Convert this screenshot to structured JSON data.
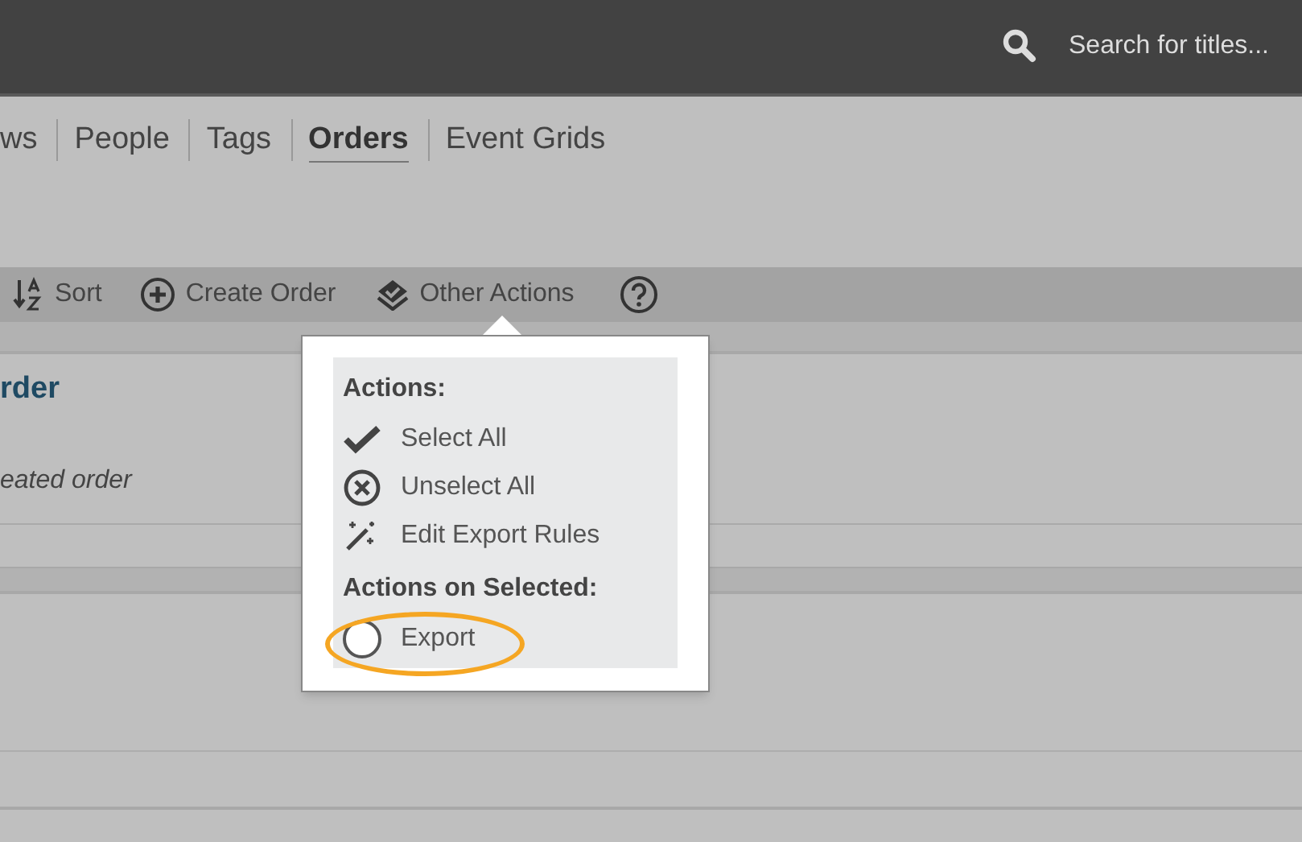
{
  "header": {
    "search_placeholder": "Search for titles..."
  },
  "tabs": [
    {
      "label": "ws",
      "selected": false
    },
    {
      "label": "People",
      "selected": false
    },
    {
      "label": "Tags",
      "selected": false
    },
    {
      "label": "Orders",
      "selected": true
    },
    {
      "label": "Event Grids",
      "selected": false
    }
  ],
  "toolbar": [
    {
      "kind": "sort",
      "label": "Sort"
    },
    {
      "kind": "create",
      "label": "Create Order"
    },
    {
      "kind": "other",
      "label": "Other Actions"
    },
    {
      "kind": "help"
    }
  ],
  "cards": [
    {
      "title": "rder",
      "subtitle": "eated order"
    }
  ],
  "menu": {
    "sections": [
      {
        "heading": "Actions:",
        "items": [
          {
            "kind": "check",
            "label": "Select All"
          },
          {
            "kind": "unselect",
            "label": "Unselect All"
          },
          {
            "kind": "wand",
            "label": "Edit Export Rules"
          }
        ]
      },
      {
        "heading": "Actions on Selected:",
        "items": [
          {
            "kind": "radio",
            "label": "Export",
            "checked": false,
            "highlighted": true
          }
        ]
      }
    ]
  }
}
